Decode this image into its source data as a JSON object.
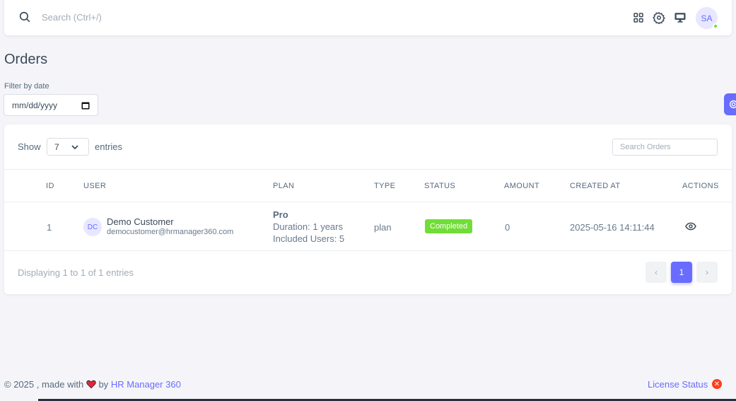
{
  "topbar": {
    "search_placeholder": "Search (Ctrl+/)",
    "icons": [
      "grid-icon",
      "gear-icon",
      "monitor-icon"
    ],
    "avatar_initials": "SA"
  },
  "page": {
    "title": "Orders",
    "filter_label": "Filter by date",
    "date_placeholder": "mm/dd/yyyy"
  },
  "table_controls": {
    "show_label": "Show",
    "entries_value": "7",
    "entries_label": "entries",
    "search_placeholder": "Search Orders"
  },
  "table": {
    "headers": [
      "ID",
      "USER",
      "PLAN",
      "TYPE",
      "STATUS",
      "AMOUNT",
      "CREATED AT",
      "ACTIONS"
    ],
    "rows": [
      {
        "id": "1",
        "user_initials": "DC",
        "user_name": "Demo Customer",
        "user_email": "democustomer@hrmanager360.com",
        "plan_name": "Pro",
        "plan_duration": "Duration: 1 years",
        "plan_users": "Included Users: 5",
        "type": "plan",
        "status": "Completed",
        "amount": "0",
        "created_at": "2025-05-16 14:11:44"
      }
    ]
  },
  "pagination": {
    "info": "Displaying 1 to 1 of 1 entries",
    "prev": "‹",
    "current": "1",
    "next": "›"
  },
  "footer": {
    "copyright": "© 2025 , made with",
    "by": "by",
    "brand": "HR Manager 360",
    "license": "License Status"
  },
  "colors": {
    "primary": "#696cff",
    "success": "#71dd37",
    "danger": "#ff3e1d"
  }
}
